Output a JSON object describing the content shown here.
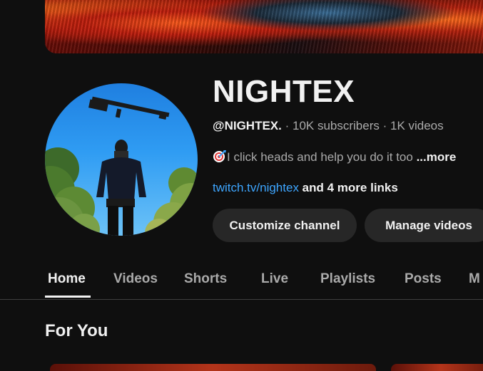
{
  "channel": {
    "name": "NIGHTEX",
    "handle": "@NIGHTEX.",
    "separator": " · ",
    "subscribers": "10K subscribers",
    "videos": "1K videos",
    "description": "I click heads and help you do it too ",
    "more_label": "...more",
    "link_text": "twitch.tv/nightex",
    "more_links": " and 4 more links"
  },
  "buttons": {
    "customize": "Customize channel",
    "manage": "Manage videos"
  },
  "tabs": [
    {
      "label": "Home",
      "active": true
    },
    {
      "label": "Videos"
    },
    {
      "label": "Shorts"
    },
    {
      "label": "Live"
    },
    {
      "label": "Playlists"
    },
    {
      "label": "Posts"
    },
    {
      "label": "M"
    }
  ],
  "section": {
    "title": "For You"
  },
  "colors": {
    "background": "#0f0f0f",
    "link": "#3ea6ff",
    "button_bg": "#272727"
  }
}
